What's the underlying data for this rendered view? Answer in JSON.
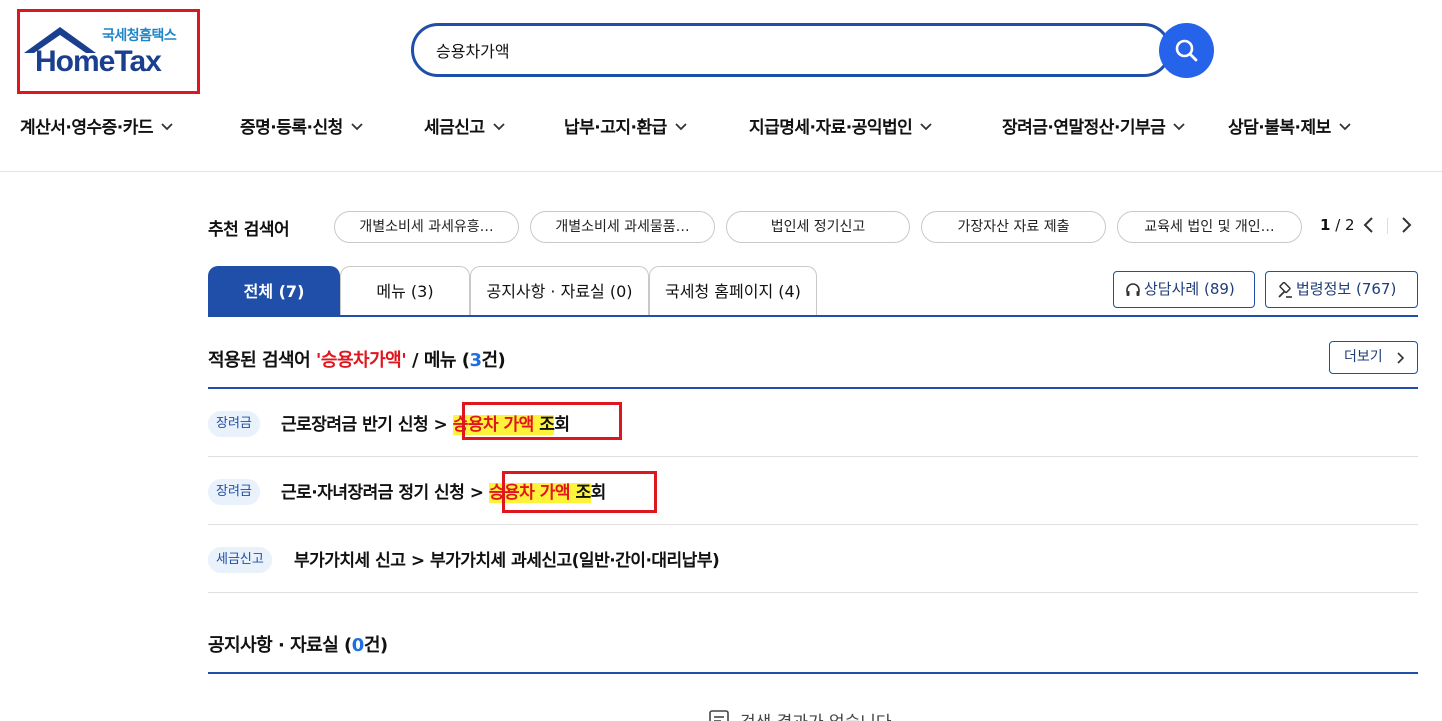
{
  "logo": {
    "sub": "국세청홈택스",
    "main": "HomeTax"
  },
  "search": {
    "value": "승용차가액"
  },
  "gnb": [
    "계산서·영수증·카드",
    "증명·등록·신청",
    "세금신고",
    "납부·고지·환급",
    "지급명세·자료·공익법인",
    "장려금·연말정산·기부금",
    "상담·불복·제보"
  ],
  "recommend": {
    "title": "추천 검색어",
    "chips": [
      "개별소비세 과세유흥…",
      "개별소비세 과세물품…",
      "법인세 정기신고",
      "가장자산 자료 제출",
      "교육세 법인 및 개인…"
    ],
    "page_current": "1",
    "page_total": "/ 2"
  },
  "tabs": [
    "전체 (7)",
    "메뉴 (3)",
    "공지사항 · 자료실 (0)",
    "국세청 홈페이지 (4)"
  ],
  "side_buttons": {
    "consult": "상담사례 (89)",
    "law": "법령정보 (767)"
  },
  "section_menu": {
    "prefix": "적용된 검색어 ",
    "keyword": "'승용차가액'",
    "mid": " / 메뉴 (",
    "count": "3",
    "suffix": "건)",
    "more": "더보기"
  },
  "results": [
    {
      "tag": "장려금",
      "path": "근로장려금 반기 신청 > ",
      "hl1": "승용차 가액",
      "hl2": " 조",
      "tail": "회"
    },
    {
      "tag": "장려금",
      "path": "근로·자녀장려금 정기 신청 > ",
      "hl1": "승용차 가액",
      "hl2": " 조",
      "tail": "회"
    },
    {
      "tag": "세금신고",
      "path": "부가가치세 신고 > 부가가치세 과세신고(일반·간이·대리납부)"
    }
  ],
  "section_notice": {
    "prefix": "공지사항 · 자료실 (",
    "count": "0",
    "suffix": "건)"
  },
  "empty_text": "검색 결과가 없습니다"
}
